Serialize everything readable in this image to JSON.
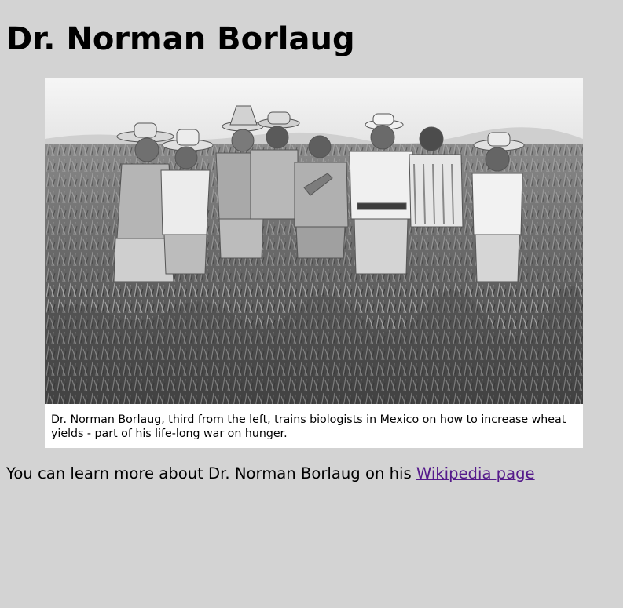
{
  "page": {
    "heading": "Dr. Norman Borlaug",
    "figure": {
      "image_alt": "Black and white photograph of men in hats standing in a wheat field",
      "caption": "Dr. Norman Borlaug, third from the left, trains biologists in Mexico on how to increase wheat yields - part of his life-long war on hunger."
    },
    "info": {
      "text": "You can learn more about Dr. Norman Borlaug on his ",
      "link_label": "Wikipedia page"
    }
  },
  "colors": {
    "page_background": "#d3d3d3",
    "figure_background": "#ffffff",
    "visited_link": "#551a8b"
  }
}
